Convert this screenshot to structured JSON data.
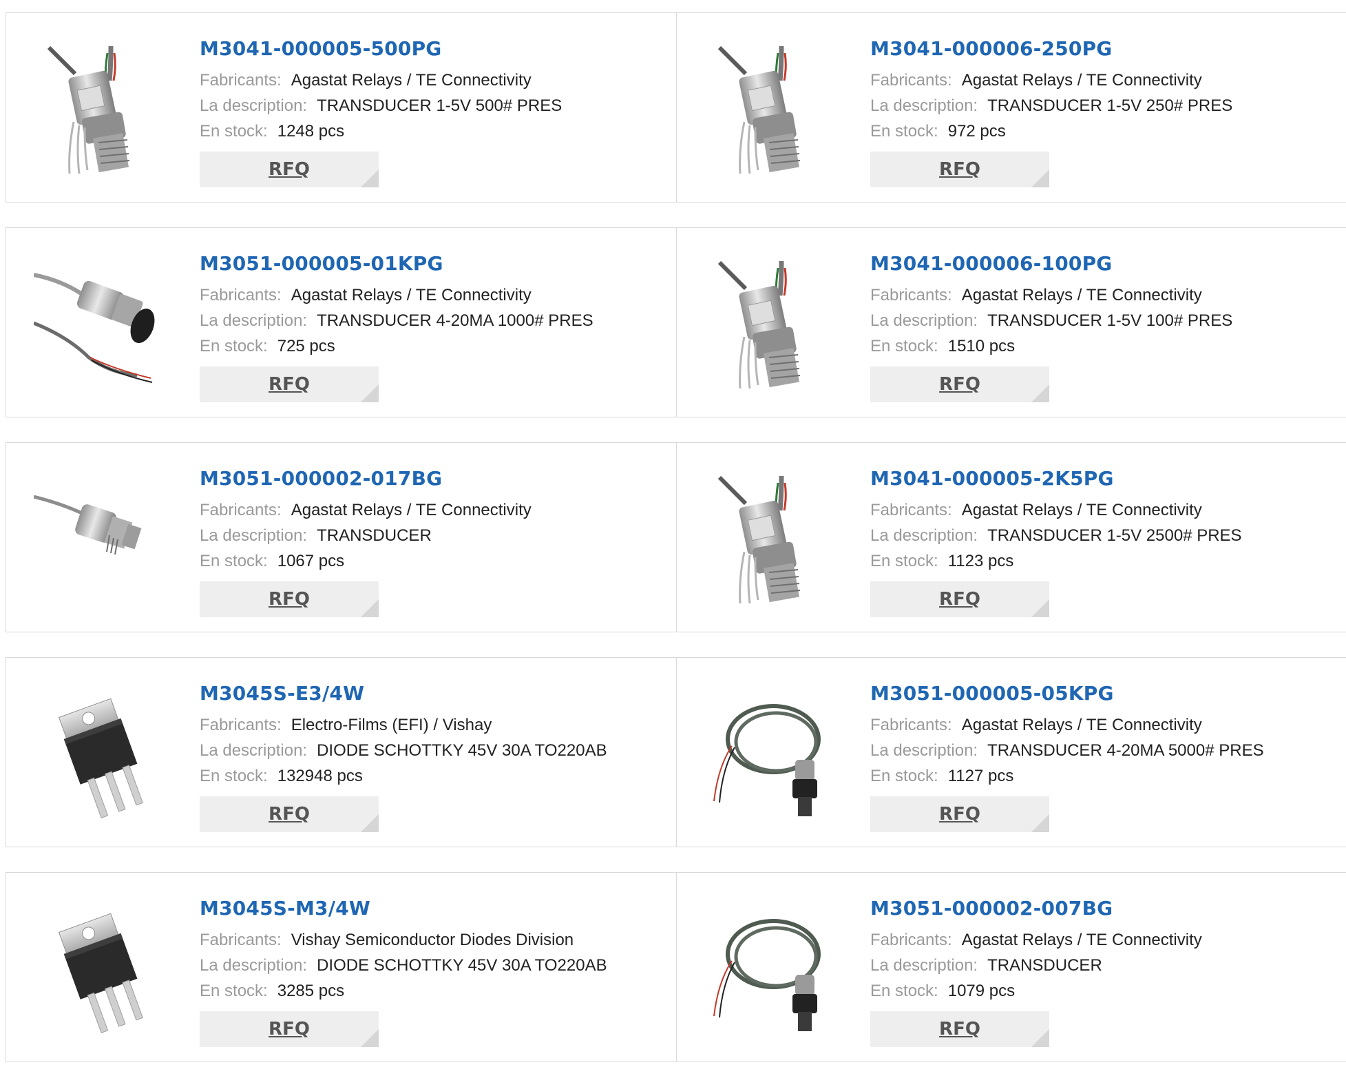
{
  "labels": {
    "manufacturer": "Fabricants:",
    "description": "La description:",
    "stock": "En stock:"
  },
  "products": [
    {
      "part": "M3041-000005-500PG",
      "manufacturer": "Agastat Relays / TE Connectivity",
      "description": "TRANSDUCER 1-5V 500# PRES",
      "stock": "1248 pcs",
      "rfq": "RFQ",
      "image": "transducer-vertical-icon"
    },
    {
      "part": "M3041-000006-250PG",
      "manufacturer": "Agastat Relays / TE Connectivity",
      "description": "TRANSDUCER 1-5V 250# PRES",
      "stock": "972 pcs",
      "rfq": "RFQ",
      "image": "transducer-vertical-icon"
    },
    {
      "part": "M3051-000005-01KPG",
      "manufacturer": "Agastat Relays / TE Connectivity",
      "description": "TRANSDUCER 4-20MA 1000# PRES",
      "stock": "725 pcs",
      "rfq": "RFQ",
      "image": "transducer-cable-icon"
    },
    {
      "part": "M3041-000006-100PG",
      "manufacturer": "Agastat Relays / TE Connectivity",
      "description": "TRANSDUCER 1-5V 100# PRES",
      "stock": "1510 pcs",
      "rfq": "RFQ",
      "image": "transducer-vertical-icon"
    },
    {
      "part": "M3051-000002-017BG",
      "manufacturer": "Agastat Relays / TE Connectivity",
      "description": "TRANSDUCER",
      "stock": "1067 pcs",
      "rfq": "RFQ",
      "image": "transducer-small-icon"
    },
    {
      "part": "M3041-000005-2K5PG",
      "manufacturer": "Agastat Relays / TE Connectivity",
      "description": "TRANSDUCER 1-5V 2500# PRES",
      "stock": "1123 pcs",
      "rfq": "RFQ",
      "image": "transducer-vertical-icon"
    },
    {
      "part": "M3045S-E3/4W",
      "manufacturer": "Electro-Films (EFI) / Vishay",
      "description": "DIODE SCHOTTKY 45V 30A TO220AB",
      "stock": "132948 pcs",
      "rfq": "RFQ",
      "image": "to220-package-icon"
    },
    {
      "part": "M3051-000005-05KPG",
      "manufacturer": "Agastat Relays / TE Connectivity",
      "description": "TRANSDUCER 4-20MA 5000# PRES",
      "stock": "1127 pcs",
      "rfq": "RFQ",
      "image": "transducer-coiled-cable-icon"
    },
    {
      "part": "M3045S-M3/4W",
      "manufacturer": "Vishay Semiconductor Diodes Division",
      "description": "DIODE SCHOTTKY 45V 30A TO220AB",
      "stock": "3285 pcs",
      "rfq": "RFQ",
      "image": "to220-package-icon"
    },
    {
      "part": "M3051-000002-007BG",
      "manufacturer": "Agastat Relays / TE Connectivity",
      "description": "TRANSDUCER",
      "stock": "1079 pcs",
      "rfq": "RFQ",
      "image": "transducer-coiled-cable-icon"
    }
  ]
}
